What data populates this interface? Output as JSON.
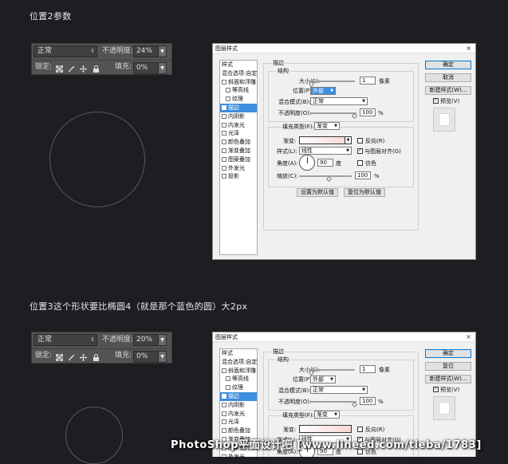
{
  "section1": {
    "heading": "位置2参数",
    "layers_panel": {
      "blend_mode": "正常",
      "opacity_label": "不透明度:",
      "opacity_value": "24%",
      "lock_label": "锁定:",
      "fill_label": "填充:",
      "fill_value": "0%"
    }
  },
  "section2": {
    "heading": "位置3这个形状要比椭圆4（就是那个蓝色的圆）大2px",
    "layers_panel": {
      "blend_mode": "正常",
      "opacity_label": "不透明度:",
      "opacity_value": "20%",
      "lock_label": "锁定:",
      "fill_label": "填充:",
      "fill_value": "0%"
    }
  },
  "dialog": {
    "title": "图层样式",
    "close_glyph": "×",
    "styles_header": "样式",
    "style_items": [
      "混合选项:自定",
      "斜面和浮雕",
      "等高线",
      "纹理",
      "描边",
      "内阴影",
      "内发光",
      "光泽",
      "颜色叠加",
      "渐变叠加",
      "图案叠加",
      "外发光",
      "投影"
    ],
    "stroke_group": "描边",
    "structure_group": "结构",
    "size_label": "大小(S):",
    "size_value": "1",
    "size_unit": "像素",
    "position_label": "位置(P):",
    "position_value": "外部",
    "blend_label": "混合模式(B):",
    "blend_value": "正常",
    "opacity_label": "不透明度(O):",
    "opacity_value": "100",
    "percent": "%",
    "fill_type_label": "填充类型(F):",
    "fill_type_value": "渐变",
    "gradient_label": "渐变:",
    "reverse_label": "反向(R)",
    "style_label": "样式(L):",
    "style_value": "线性",
    "align_label": "与图层对齐(G)",
    "dither_label": "仿色",
    "angle_label": "角度(A):",
    "angle_value": "90",
    "degree": "度",
    "scale_label": "缩放(C):",
    "scale_value": "100",
    "set_default": "设置为默认值",
    "reset_default": "复位为默认值",
    "ok": "确定",
    "cancel": "取消",
    "reset": "复位",
    "new_style": "新建样式(W)...",
    "preview_label": "预览(V)"
  },
  "watermark": "PhotoShop平面设计吧  [www.lineed.com/tieba/1783]"
}
